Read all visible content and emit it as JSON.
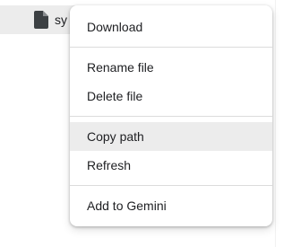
{
  "file_browser": {
    "file_name": "sy",
    "file_icon": "file-icon"
  },
  "context_menu": {
    "items": {
      "download": "Download",
      "rename": "Rename file",
      "delete": "Delete file",
      "copy_path": "Copy path",
      "refresh": "Refresh",
      "add_to_gemini": "Add to Gemini"
    },
    "highlighted_item": "Copy path"
  },
  "colors": {
    "highlight_bg": "#ececec",
    "text": "#202124",
    "divider": "#dcdcdc",
    "icon": "#3c4043"
  }
}
